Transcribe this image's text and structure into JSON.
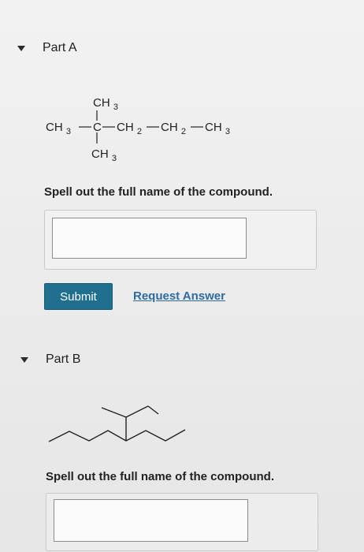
{
  "partA": {
    "title": "Part A",
    "formula": {
      "ch3_top": "CH3",
      "ch3_left": "CH3",
      "carbon": "C",
      "ch2_1": "CH2",
      "ch2_2": "CH2",
      "ch3_right": "CH3",
      "ch3_bottom": "CH3"
    },
    "prompt": "Spell out the full name of the compound.",
    "answer_value": ""
  },
  "actions": {
    "submit_label": "Submit",
    "request_label": "Request Answer"
  },
  "partB": {
    "title": "Part B",
    "prompt": "Spell out the full name of the compound.",
    "answer_value": ""
  },
  "colors": {
    "submit_bg": "#1f6f8f",
    "link": "#2f6aa0"
  }
}
